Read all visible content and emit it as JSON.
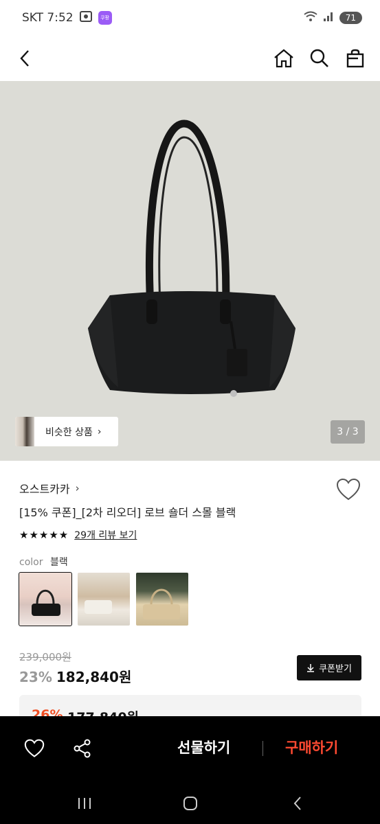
{
  "status_bar": {
    "carrier_time": "SKT 7:52",
    "app_badge": "쿠팡",
    "battery": "71"
  },
  "header": {
    "back_label": "back",
    "home_label": "home",
    "search_label": "search",
    "cart_label": "cart"
  },
  "gallery": {
    "similar_label": "비슷한 상품",
    "page_indicator": "3 / 3"
  },
  "product": {
    "brand": "오스트카카",
    "title": "[15% 쿠폰]_[2차 리오더] 로브 숄더 스몰 블랙",
    "stars": "★★★★★",
    "rating": 5,
    "review_link": "29개 리뷰 보기",
    "color_label": "color",
    "color_value": "블랙",
    "swatches": [
      "블랙",
      "아이보리",
      "베이지"
    ],
    "price_original": "239,000원",
    "discount_rate": "23%",
    "price_final": "182,840원",
    "coupon_button": "쿠폰받기",
    "coupon_discount": "26%",
    "coupon_price": "177,840원"
  },
  "action_bar": {
    "gift_label": "선물하기",
    "buy_label": "구매하기"
  },
  "colors": {
    "accent": "#ff4a32",
    "coupon_red": "#f04e23",
    "hero_bg": "#dcdcd6"
  }
}
